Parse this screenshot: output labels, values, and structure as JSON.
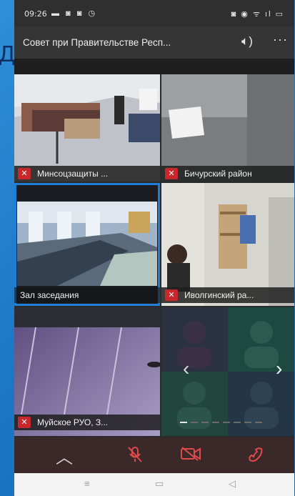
{
  "background_fragment": "Д",
  "status_bar": {
    "time": "09:26",
    "left_icons": "▬ ◙ ◙ ◷",
    "right_icons": "◙ ◉ ᯤ ıl ▭"
  },
  "meeting": {
    "title": "Совет при Правительстве Респ...",
    "speaker_icon": "speaker-icon",
    "more_icon": "more-icon"
  },
  "tiles": [
    {
      "name": "Минсоцзащиты ...",
      "muted": true
    },
    {
      "name": "Бичурский район",
      "muted": true
    },
    {
      "name": "Зал заседания",
      "muted": false,
      "selected": true
    },
    {
      "name": "Иволгинский ра...",
      "muted": true
    },
    {
      "name": "Муйское РУО, З...",
      "muted": true
    }
  ],
  "pager": {
    "pages": 8,
    "current": 1
  },
  "controls": {
    "collapse": "^",
    "mic_off": "mic-off-icon",
    "video_off": "video-off-icon",
    "hangup": "hangup-icon"
  },
  "nav": {
    "menu": "≡",
    "home": "▭",
    "back": "◁"
  }
}
